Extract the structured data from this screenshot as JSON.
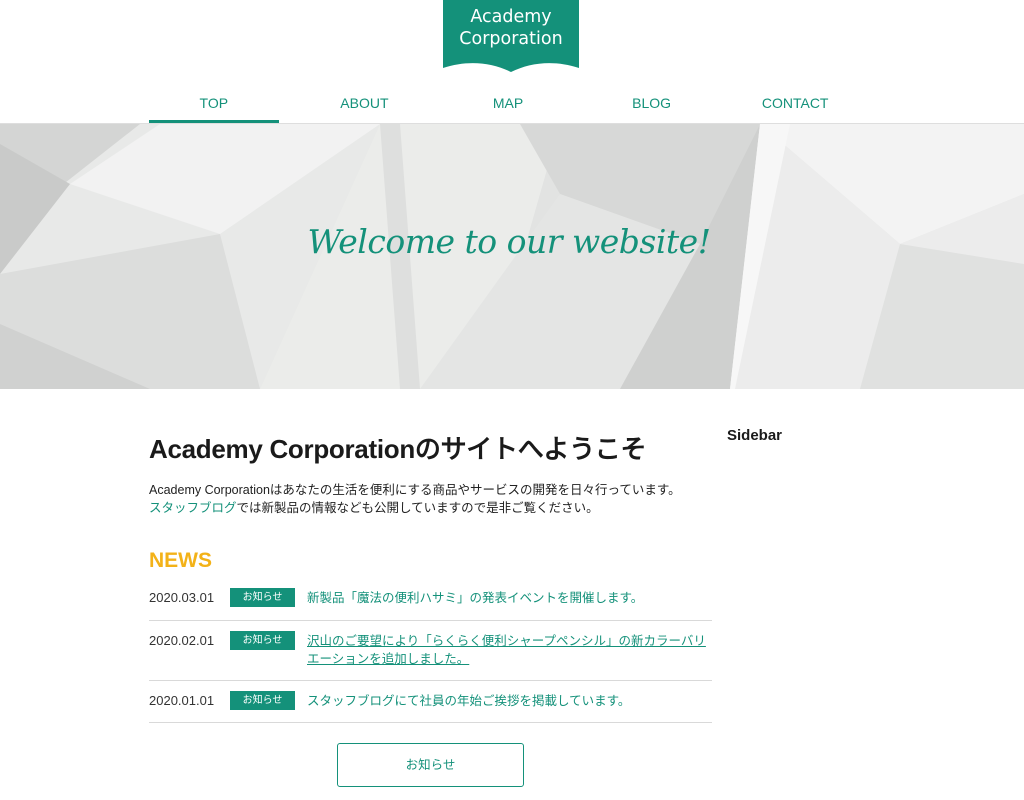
{
  "header": {
    "logo": {
      "line1": "Academy",
      "line2": "Corporation"
    },
    "nav": [
      {
        "label": "TOP",
        "active": true
      },
      {
        "label": "ABOUT",
        "active": false
      },
      {
        "label": "MAP",
        "active": false
      },
      {
        "label": "BLOG",
        "active": false
      },
      {
        "label": "CONTACT",
        "active": false
      }
    ]
  },
  "hero": {
    "title": "Welcome to our website!"
  },
  "main": {
    "title": "Academy Corporationのサイトへようこそ",
    "intro_line1": "Academy Corporationはあなたの生活を便利にする商品やサービスの開発を日々行っています。",
    "intro_link": "スタッフブログ",
    "intro_line2_rest": "では新製品の情報なども公開していますので是非ご覧ください。",
    "news_heading": "NEWS",
    "news": [
      {
        "date": "2020.03.01",
        "badge": "お知らせ",
        "text": "新製品「魔法の便利ハサミ」の発表イベントを開催します。"
      },
      {
        "date": "2020.02.01",
        "badge": "お知らせ",
        "text": "沢山のご要望により「らくらく便利シャープペンシル」の新カラーバリエーションを追加しました。"
      },
      {
        "date": "2020.01.01",
        "badge": "お知らせ",
        "text": "スタッフブログにて社員の年始ご挨拶を掲載しています。"
      }
    ],
    "more_button": "お知らせ"
  },
  "sidebar": {
    "title": "Sidebar"
  },
  "colors": {
    "accent": "#14917a",
    "news_heading": "#f3b218",
    "hero_bg": "#e2e3e2"
  }
}
